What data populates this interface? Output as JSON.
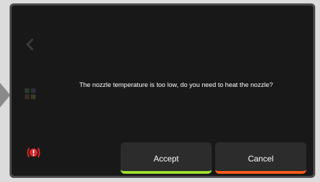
{
  "dialog": {
    "message": "The nozzle temperature is too low, do you need to heat the nozzle?",
    "accept_label": "Accept",
    "cancel_label": "Cancel"
  },
  "colors": {
    "accept_accent": "#9ee02b",
    "cancel_accent": "#ff5c16",
    "alert": "#e0262a"
  },
  "icons": {
    "back": "chevron-left-icon",
    "apps": "apps-grid-icon",
    "alert": "alert-icon",
    "nav": "left-arrow-icon"
  }
}
